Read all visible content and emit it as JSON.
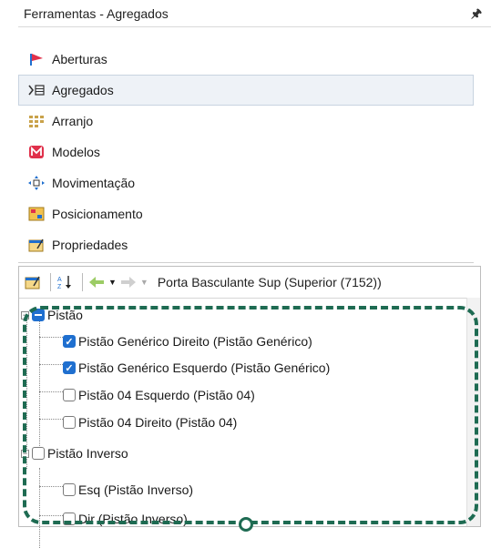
{
  "window": {
    "title": "Ferramentas - Agregados",
    "pin_icon": "pin-icon"
  },
  "sections": [
    {
      "label": "Aberturas",
      "icon": "aberturas-icon",
      "selected": false
    },
    {
      "label": "Agregados",
      "icon": "agregados-icon",
      "selected": true
    },
    {
      "label": "Arranjo",
      "icon": "arranjo-icon",
      "selected": false
    },
    {
      "label": "Modelos",
      "icon": "modelos-icon",
      "selected": false
    },
    {
      "label": "Movimentação",
      "icon": "movimentacao-icon",
      "selected": false
    },
    {
      "label": "Posicionamento",
      "icon": "posicionamento-icon",
      "selected": false
    },
    {
      "label": "Propriedades",
      "icon": "propriedades-icon",
      "selected": false
    }
  ],
  "toolbar": {
    "object_label": "Porta Basculante Sup (Superior (7152))"
  },
  "tree": [
    {
      "label": "Pistão",
      "level": 0,
      "state": "partial",
      "expanded": true
    },
    {
      "label": "Pistão Genérico Direito (Pistão Genérico)",
      "level": 1,
      "state": "checked"
    },
    {
      "label": "Pistão Genérico Esquerdo (Pistão Genérico)",
      "level": 1,
      "state": "checked"
    },
    {
      "label": "Pistão 04 Esquerdo (Pistão 04)",
      "level": 1,
      "state": "unchecked"
    },
    {
      "label": "Pistão 04 Direito (Pistão 04)",
      "level": 1,
      "state": "unchecked"
    },
    {
      "label": "Pistão Inverso",
      "level": 0,
      "state": "unchecked",
      "expanded": true
    },
    {
      "label": "Esq (Pistão Inverso)",
      "level": 1,
      "state": "unchecked"
    },
    {
      "label": "Dir (Pistão Inverso)",
      "level": 1,
      "state": "unchecked"
    }
  ],
  "colors": {
    "checked": "#1f6fcf",
    "highlight": "#1e6b52",
    "selected_bg": "#eef2f7"
  }
}
